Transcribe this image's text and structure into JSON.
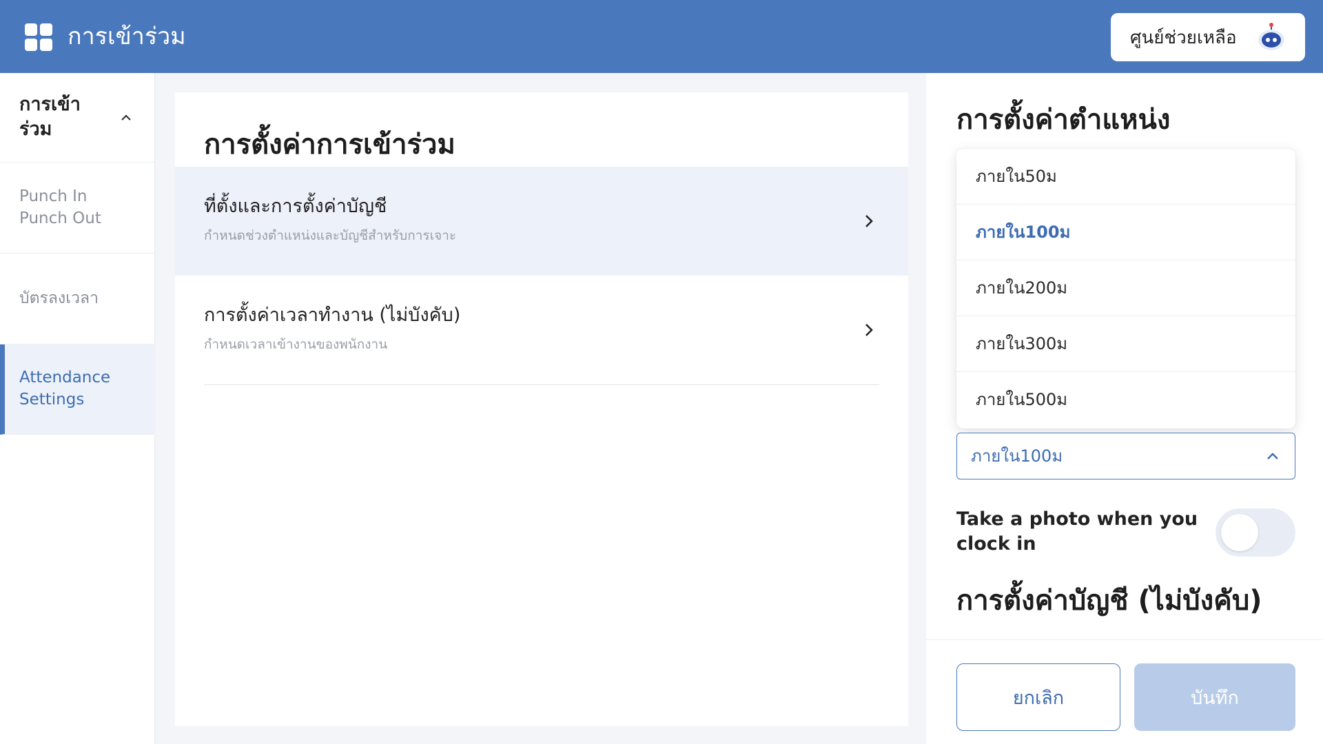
{
  "header": {
    "app_title": "การเข้าร่วม",
    "help_label": "ศูนย์ช่วยเหลือ",
    "accent_color": "#4a78bd",
    "app_icon": "grid-icon",
    "help_icon": "robot-icon"
  },
  "sidebar": {
    "group_label": "การเข้าร่วม",
    "items": [
      {
        "label": "Punch In Punch Out"
      },
      {
        "label": "บัตรลงเวลา"
      },
      {
        "label": "Attendance Settings",
        "active": true
      }
    ]
  },
  "main": {
    "title": "การตั้งค่าการเข้าร่วม",
    "rows": [
      {
        "title": "ที่ตั้งและการตั้งค่าบัญชี",
        "subtitle": "กำหนดช่วงตำแหน่งและบัญชีสำหรับการเจาะ",
        "selected": true
      },
      {
        "title": "การตั้งค่าเวลาทำงาน (ไม่บังคับ)",
        "subtitle": "กำหนดเวลาเข้างานของพนักงาน"
      }
    ]
  },
  "panel": {
    "title": "การตั้งค่าตำแหน่ง",
    "dropdown_options": [
      "ภายใน50ม",
      "ภายใน100ม",
      "ภายใน200ม",
      "ภายใน300ม",
      "ภายใน500ม"
    ],
    "selected_option": "ภายใน100ม",
    "photo_label": "Take a photo when you clock in",
    "photo_toggle_on": false,
    "account_title": "การตั้งค่าบัญชี (ไม่บังคับ)",
    "cancel_label": "ยกเลิก",
    "save_label": "บันทึก"
  }
}
